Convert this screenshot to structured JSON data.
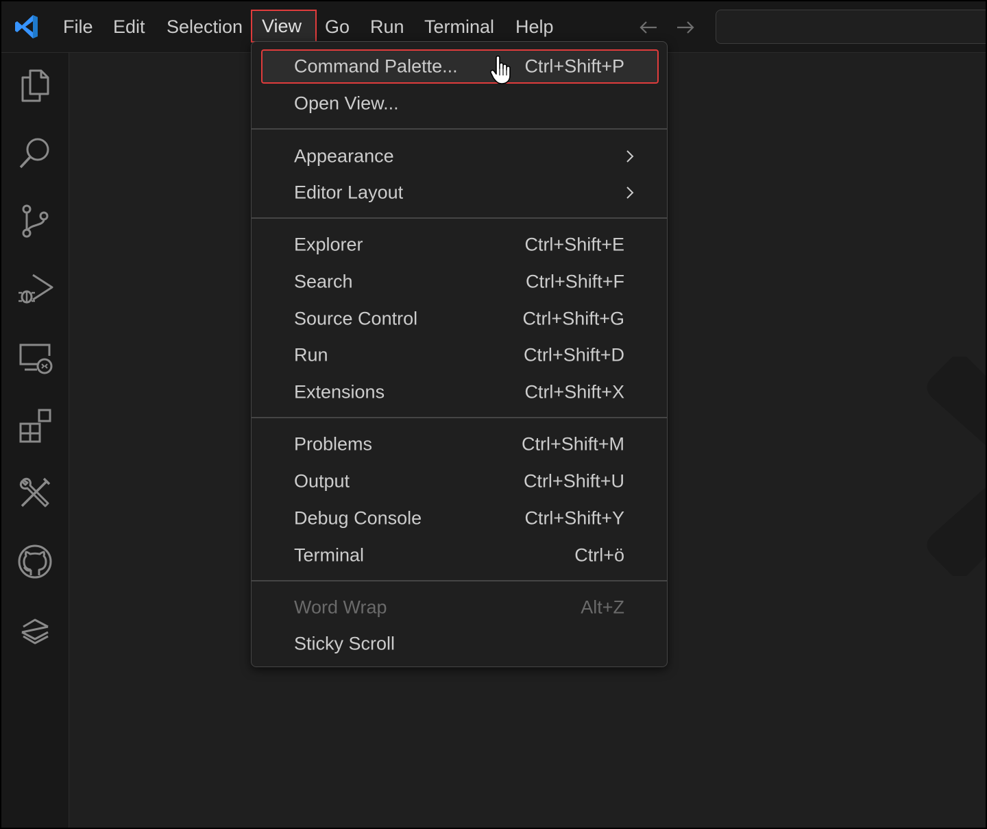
{
  "menubar": {
    "items": [
      "File",
      "Edit",
      "Selection",
      "View",
      "Go",
      "Run",
      "Terminal",
      "Help"
    ],
    "active": "View"
  },
  "activity_icons": [
    "explorer-icon",
    "search-icon",
    "source-control-icon",
    "run-debug-icon",
    "remote-explorer-icon",
    "extensions-icon",
    "tools-icon",
    "github-icon",
    "layers-icon"
  ],
  "view_menu": {
    "command_palette": {
      "label": "Command Palette...",
      "shortcut": "Ctrl+Shift+P"
    },
    "open_view": {
      "label": "Open View..."
    },
    "appearance": {
      "label": "Appearance"
    },
    "editor_layout": {
      "label": "Editor Layout"
    },
    "explorer": {
      "label": "Explorer",
      "shortcut": "Ctrl+Shift+E"
    },
    "search": {
      "label": "Search",
      "shortcut": "Ctrl+Shift+F"
    },
    "source_control": {
      "label": "Source Control",
      "shortcut": "Ctrl+Shift+G"
    },
    "run": {
      "label": "Run",
      "shortcut": "Ctrl+Shift+D"
    },
    "extensions": {
      "label": "Extensions",
      "shortcut": "Ctrl+Shift+X"
    },
    "problems": {
      "label": "Problems",
      "shortcut": "Ctrl+Shift+M"
    },
    "output": {
      "label": "Output",
      "shortcut": "Ctrl+Shift+U"
    },
    "debug_console": {
      "label": "Debug Console",
      "shortcut": "Ctrl+Shift+Y"
    },
    "terminal": {
      "label": "Terminal",
      "shortcut": "Ctrl+ö"
    },
    "word_wrap": {
      "label": "Word Wrap",
      "shortcut": "Alt+Z"
    },
    "sticky_scroll": {
      "label": "Sticky Scroll"
    }
  },
  "colors": {
    "highlight_border": "#e03c3c",
    "accent": "#3794ff"
  }
}
